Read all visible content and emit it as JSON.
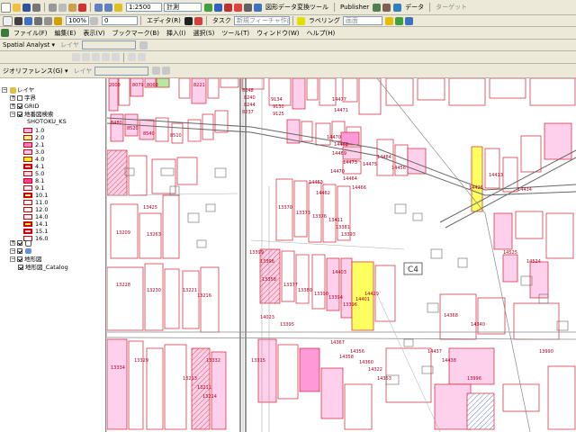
{
  "toolbar1": {
    "scale": "1:2500",
    "layer_dropdown": "計測",
    "custom_tools": "図形データ変換ツール",
    "publisher": "Publisher",
    "input_label": "データ",
    "editor": "エディタ(R)",
    "task_label": "タスク",
    "task_value": "新規フィーチャ作成",
    "target_label": "ターゲット"
  },
  "toolbar2": {
    "zoom": "100%",
    "zero": "0",
    "labeling": "ラベリング",
    "highlight": "画面"
  },
  "menubar": [
    "ファイル(F)",
    "編集(E)",
    "表示(V)",
    "ブックマーク(B)",
    "挿入(I)",
    "選択(S)",
    "ツール(T)",
    "ウィンドウ(W)",
    "ヘルプ(H)"
  ],
  "spatial_analyst": {
    "label": "Spatial Analyst ▾",
    "layer": "レイヤ"
  },
  "georef": {
    "label": "ジオリファレンス(G) ▾",
    "layer": "レイヤ"
  },
  "toc": {
    "root": "レイヤ",
    "layers": [
      "字界",
      "GRID",
      "地番図検索"
    ],
    "field": "SHOTOKU_KS",
    "classes": [
      "1.0",
      "2.0",
      "2.1",
      "3.0",
      "4.0",
      "4.1",
      "5.0",
      "8.1",
      "9.1",
      "10.1",
      "11.0",
      "12.0",
      "14.0",
      "14.1",
      "15.1",
      "16.0"
    ],
    "bottom_layers": [
      "地形図",
      "地形図_Catalog"
    ]
  },
  "map": {
    "c4_label": "C4",
    "parcels": [
      "2000",
      "8079",
      "8060",
      "8221",
      "8248",
      "8240",
      "8244",
      "8237",
      "9134",
      "9130",
      "9125",
      "14477",
      "14471",
      "8480",
      "8520",
      "8540",
      "8510",
      "14470",
      "14468",
      "14469",
      "14473",
      "14470",
      "14463",
      "14475",
      "14464",
      "14466",
      "14462",
      "14484",
      "14456",
      "13425",
      "13370",
      "13373",
      "13376",
      "13411",
      "13381",
      "13393",
      "14426",
      "14413",
      "14434",
      "13209",
      "13263",
      "13399",
      "13396",
      "13228",
      "13230",
      "13358",
      "13377",
      "13380",
      "13390",
      "13394",
      "13396",
      "14401",
      "14429",
      "14525",
      "14524",
      "13221",
      "13216",
      "13213",
      "13211",
      "13332",
      "13334",
      "13329",
      "14367",
      "14358",
      "14356",
      "14360",
      "14322",
      "14353",
      "14368",
      "14340",
      "13990",
      "13996",
      "14023",
      "13395",
      "14403",
      "13214",
      "13315",
      "14437",
      "14438"
    ]
  }
}
